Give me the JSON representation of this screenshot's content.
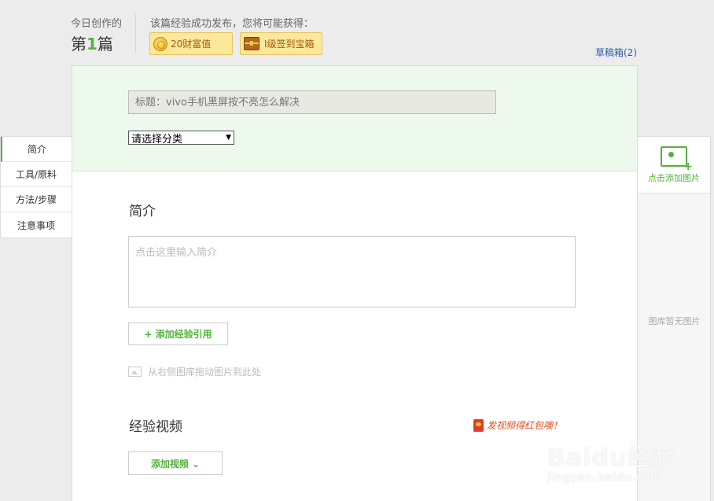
{
  "header": {
    "today_label": "今日创作的",
    "count_prefix": "第",
    "count_number": "1",
    "count_suffix": "篇",
    "reward_text": "该篇经验成功发布，您将可能获得：",
    "badges": [
      {
        "label": "20财富值",
        "icon": "coin-icon"
      },
      {
        "label": "I级签到宝箱",
        "icon": "treasure-chest-icon"
      }
    ],
    "drafts_link": "草稿箱(2)"
  },
  "editor": {
    "title_placeholder": "标题：vivo手机黑屏按不亮怎么解决",
    "category_select": "请选择分类",
    "intro_heading": "简介",
    "intro_placeholder": "点击这里输入简介",
    "add_reference_button": "+ 添加经验引用",
    "drag_hint": "从右侧图库拖动图片到此处",
    "video_heading": "经验视频",
    "video_promo": "发视频得红包噢！",
    "add_video_button": "添加视频 ⌄"
  },
  "left_nav": {
    "items": [
      "简介",
      "工具/原料",
      "方法/步骤",
      "注意事项"
    ],
    "active_index": 0
  },
  "gallery": {
    "add_image_label": "点击添加图片",
    "empty_text": "图库暂无图片"
  },
  "watermark": {
    "logo": "Baidu经验",
    "url": "jingyan.baidu.com"
  },
  "colors": {
    "accent_green": "#56b13e",
    "title_area_bg": "#eef9ee",
    "badge_bg": "#fbe89a",
    "link_blue": "#2b5fa8",
    "promo_red": "#e6491a"
  }
}
